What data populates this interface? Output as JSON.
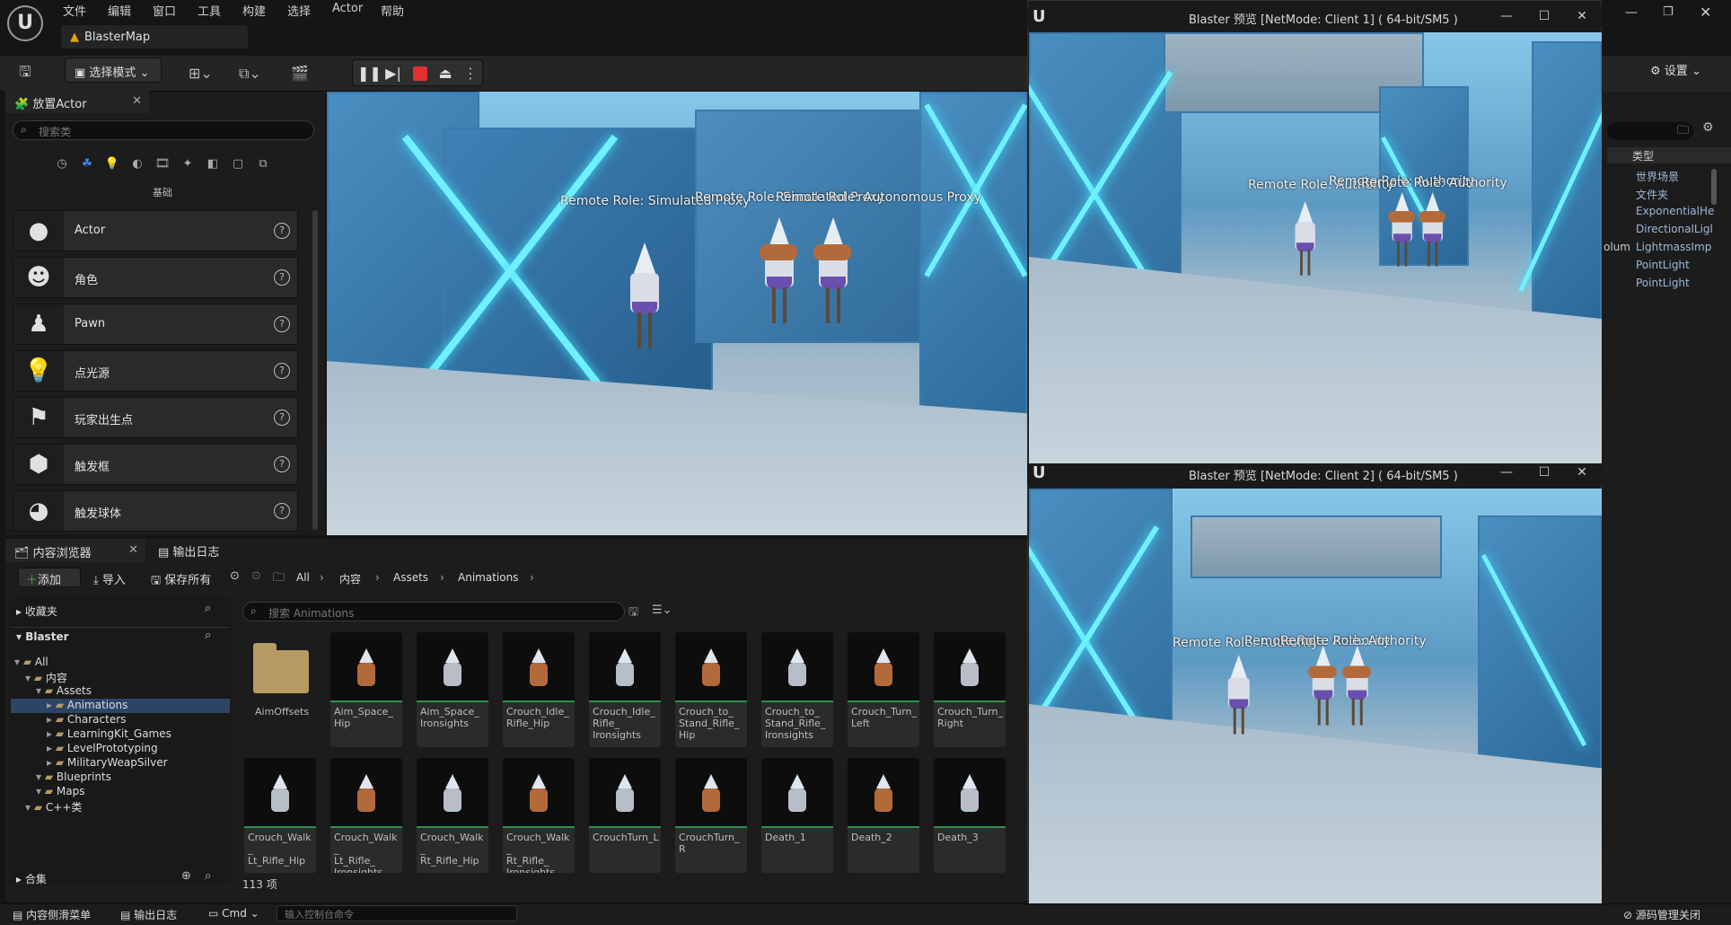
{
  "menu": {
    "items": [
      "文件",
      "编辑",
      "窗口",
      "工具",
      "构建",
      "选择",
      "Actor",
      "帮助"
    ]
  },
  "map_tab": {
    "label": "BlasterMap"
  },
  "toolbar": {
    "mode_label": "选择模式",
    "settings_label": "设置"
  },
  "place_actor": {
    "tab_label": "放置Actor",
    "search_placeholder": "搜索类",
    "category_label": "基础",
    "items": [
      "Actor",
      "角色",
      "Pawn",
      "点光源",
      "玩家出生点",
      "触发框",
      "触发球体"
    ]
  },
  "main_viewport": {
    "role_text_1": "Remote Role: Simulated Proxy",
    "role_text_2": "Remote Role: Simulated Proxy",
    "role_text_3": "Remote Role: Autonomous Proxy"
  },
  "client1": {
    "title": "Blaster 预览 [NetMode: Client 1]  ( 64-bit/SM5 )",
    "role_text_1": "Remote Role: Authority",
    "role_text_2": "Remote Role: Authority",
    "role_text_3": "Remote Role: Authority"
  },
  "client2": {
    "title": "Blaster 预览 [NetMode: Client 2]  ( 64-bit/SM5 )",
    "role_text_1": "Remote Role: Authority",
    "role_text_2": "Remote Role: Authority",
    "role_text_3": "Remote Role: Authority"
  },
  "content_browser": {
    "tab_label": "内容浏览器",
    "output_tab_label": "输出日志",
    "add_label": "添加",
    "import_label": "导入",
    "save_all_label": "保存所有",
    "breadcrumb": [
      "All",
      "内容",
      "Assets",
      "Animations"
    ],
    "favorites_label": "收藏夹",
    "project_label": "Blaster",
    "search_placeholder": "搜索 Animations",
    "collections_label": "合集",
    "item_count": "113 项",
    "tree": [
      {
        "label": "All",
        "depth": 0
      },
      {
        "label": "内容",
        "depth": 1
      },
      {
        "label": "Assets",
        "depth": 2
      },
      {
        "label": "Animations",
        "depth": 3
      },
      {
        "label": "Characters",
        "depth": 3
      },
      {
        "label": "LearningKit_Games",
        "depth": 3
      },
      {
        "label": "LevelPrototyping",
        "depth": 3
      },
      {
        "label": "MilitaryWeapSilver",
        "depth": 3
      },
      {
        "label": "Blueprints",
        "depth": 2
      },
      {
        "label": "Maps",
        "depth": 2
      },
      {
        "label": "C++类",
        "depth": 1
      }
    ],
    "folder_asset": "AimOffsets",
    "row1": [
      "Aim_Space_\nHip",
      "Aim_Space_\nIronsights",
      "Crouch_Idle_\nRifle_Hip",
      "Crouch_Idle_\nRifle_\nIronsights",
      "Crouch_to_\nStand_Rifle_\nHip",
      "Crouch_to_\nStand_Rifle_\nIronsights",
      "Crouch_Turn_\nLeft",
      "Crouch_Turn_\nRight"
    ],
    "row2": [
      "Crouch_Walk_\nLt_Rifle_Hip",
      "Crouch_Walk_\nLt_Rifle_\nIronsights",
      "Crouch_Walk_\nRt_Rifle_Hip",
      "Crouch_Walk_\nRt_Rifle_\nIronsights",
      "CrouchTurn_L",
      "CrouchTurn_R",
      "Death_1",
      "Death_2",
      "Death_3"
    ]
  },
  "right_panel": {
    "type_header": "类型",
    "items": [
      "世界场景",
      "文件夹",
      "ExponentialHe",
      "DirectionalLigl",
      "LightmassImp",
      "PointLight",
      "PointLight"
    ],
    "column_hint": "olum"
  },
  "statusbar": {
    "drawer_label": "内容侧滑菜单",
    "output_label": "输出日志",
    "cmd_label": "Cmd",
    "console_placeholder": "输入控制台命令",
    "source_control_label": "源码管理关闭"
  }
}
